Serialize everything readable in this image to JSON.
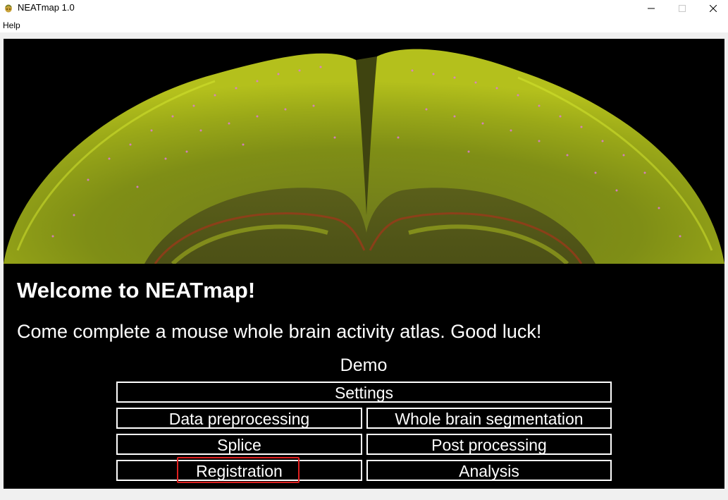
{
  "window": {
    "title": "NEATmap 1.0",
    "icon": "neatmap-app-icon"
  },
  "menu": {
    "items": [
      {
        "label": "Help"
      }
    ]
  },
  "main": {
    "banner_image": "brain-coronal-section-image",
    "welcome": "Welcome to NEATmap!",
    "subtitle": "Come complete a mouse whole brain activity atlas. Good luck!",
    "demo_label": "Demo",
    "buttons": {
      "settings": "Settings",
      "data_preprocessing": "Data preprocessing",
      "whole_brain_segmentation": "Whole brain segmentation",
      "splice": "Splice",
      "post_processing": "Post processing",
      "registration": "Registration",
      "analysis": "Analysis"
    },
    "highlighted_button": "registration"
  },
  "colors": {
    "background": "#000000",
    "text": "#ffffff",
    "button_border": "#ffffff",
    "highlight": "#e02020"
  }
}
